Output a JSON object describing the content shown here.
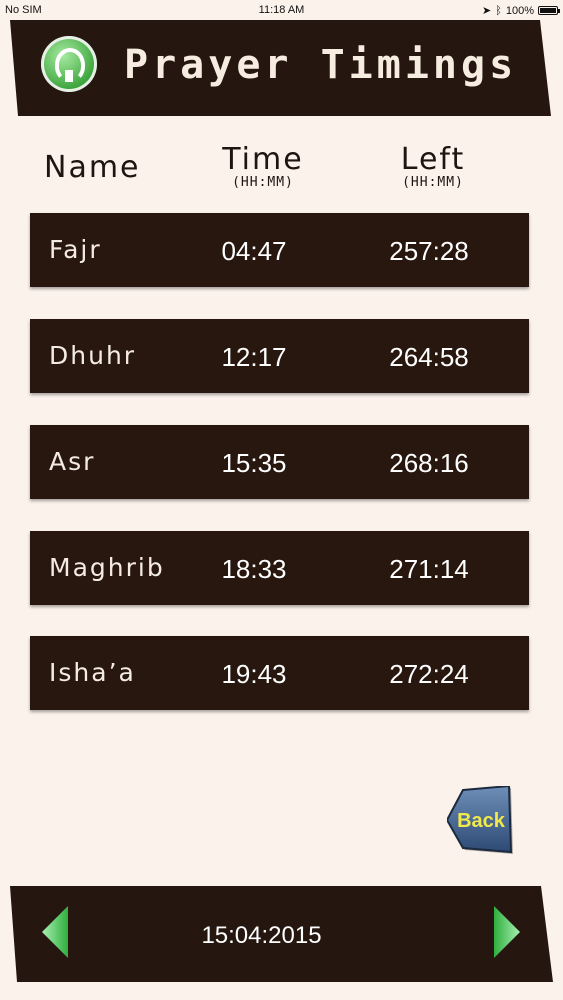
{
  "status_bar": {
    "carrier": "No SIM",
    "time": "11:18 AM",
    "battery": "100%"
  },
  "header": {
    "title": "Prayer Timings",
    "logo_icon": "masjid-logo-icon",
    "colors": {
      "bar": "#25170f",
      "title": "#f6ece0"
    }
  },
  "columns": {
    "name": "Name",
    "time": "Time",
    "time_unit": "(HH:MM)",
    "left": "Left",
    "left_unit": "(HH:MM)"
  },
  "prayers": [
    {
      "name": "Fajr",
      "time": "04:47",
      "left": "257:28"
    },
    {
      "name": "Dhuhr",
      "time": "12:17",
      "left": "264:58"
    },
    {
      "name": "Asr",
      "time": "15:35",
      "left": "268:16"
    },
    {
      "name": "Maghrib",
      "time": "18:33",
      "left": "271:14"
    },
    {
      "name": "Isha’a",
      "time": "19:43",
      "left": "272:24"
    }
  ],
  "back_button": {
    "label": "Back",
    "color": "#f2e84a"
  },
  "footer": {
    "date": "15:04:2015",
    "prev_icon": "left-arrow-icon",
    "next_icon": "right-arrow-icon",
    "arrow_color": "#5fd36a"
  }
}
